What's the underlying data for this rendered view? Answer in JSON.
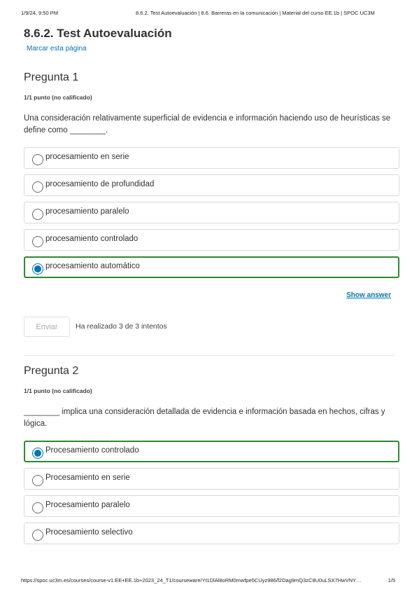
{
  "print_header": {
    "date": "1/9/24, 9:50 PM",
    "title": "8.6.2. Test Autoevaluación | 8.6. Barreras en la comunicación | Material del curso EE.1b | SPOC UC3M"
  },
  "page": {
    "title": "8.6.2. Test Autoevaluación",
    "bookmark": "Marcar esta página"
  },
  "questions": [
    {
      "heading": "Pregunta 1",
      "points": "1/1 punto (no calificado)",
      "text": "Una consideración relativamente superficial de evidencia e información haciendo uso de heurísticas se define como ________.",
      "options": [
        {
          "label": "procesamiento en serie",
          "selected": false
        },
        {
          "label": "procesamiento de profundidad",
          "selected": false
        },
        {
          "label": "procesamiento paralelo",
          "selected": false
        },
        {
          "label": "procesamiento controlado",
          "selected": false
        },
        {
          "label": "procesamiento automático",
          "selected": true
        }
      ],
      "show_answer": "Show answer",
      "submit_label": "Enviar",
      "attempts": "Ha realizado 3 de 3 intentos"
    },
    {
      "heading": "Pregunta 2",
      "points": "1/1 punto (no calificado)",
      "text": "________ implica una consideración detallada de evidencia e información basada en hechos, cifras y lógica.",
      "options": [
        {
          "label": "Procesamiento controlado",
          "selected": true
        },
        {
          "label": "Procesamiento en serie",
          "selected": false
        },
        {
          "label": "Procesamiento paralelo",
          "selected": false
        },
        {
          "label": "Procesamiento selectivo",
          "selected": false
        }
      ]
    }
  ],
  "print_footer": {
    "url": "https://spoc.uc3m.es/courses/course-v1:EE+EE.1b+2023_24_T1/courseware/Yt1DlAl8oRM0mwfpe5CUyz986/f2Dag9mQ3zC8U0uLSX7HwVNY…",
    "page": "1/5"
  },
  "colors": {
    "accent": "#0075b4",
    "selected_border": "#2d8a2d",
    "text": "#313131"
  }
}
